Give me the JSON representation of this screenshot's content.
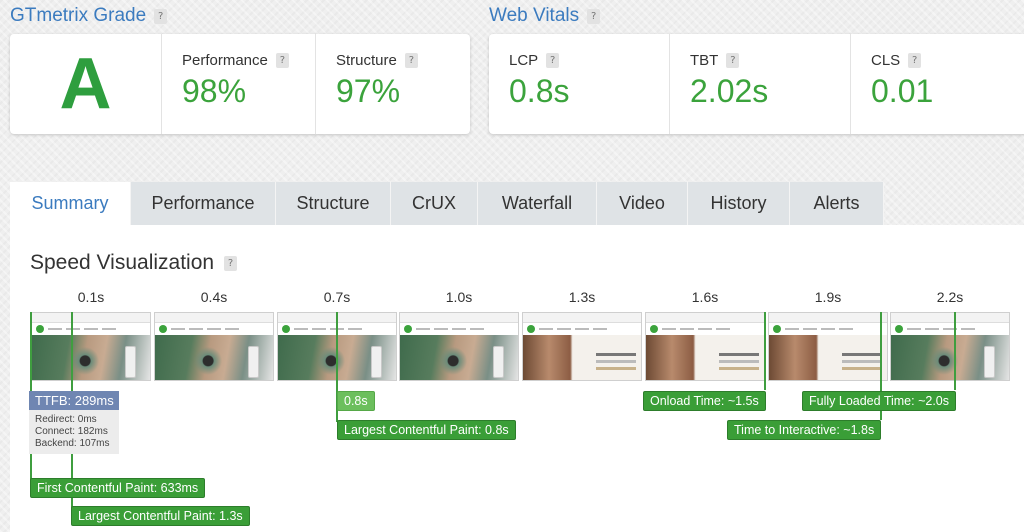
{
  "grade_section": {
    "title": "GTmetrix Grade",
    "grade": "A",
    "metrics": [
      {
        "label": "Performance",
        "value": "98%"
      },
      {
        "label": "Structure",
        "value": "97%"
      }
    ]
  },
  "vitals_section": {
    "title": "Web Vitals",
    "metrics": [
      {
        "label": "LCP",
        "value": "0.8s"
      },
      {
        "label": "TBT",
        "value": "2.02s"
      },
      {
        "label": "CLS",
        "value": "0.01"
      }
    ]
  },
  "help_glyph": "?",
  "tabs": [
    {
      "label": "Summary",
      "active": true
    },
    {
      "label": "Performance"
    },
    {
      "label": "Structure"
    },
    {
      "label": "CrUX"
    },
    {
      "label": "Waterfall"
    },
    {
      "label": "Video"
    },
    {
      "label": "History"
    },
    {
      "label": "Alerts"
    }
  ],
  "speed_viz": {
    "title": "Speed Visualization",
    "time_labels": [
      "0.1s",
      "0.4s",
      "0.7s",
      "1.0s",
      "1.3s",
      "1.6s",
      "1.9s",
      "2.2s"
    ],
    "ttfb": {
      "label": "TTFB: 289ms",
      "redirect": "Redirect: 0ms",
      "connect": "Connect: 182ms",
      "backend": "Backend: 107ms"
    },
    "markers": {
      "lcp_short": "0.8s",
      "lcp": "Largest Contentful Paint: 0.8s",
      "onload": "Onload Time: ~1.5s",
      "fully_loaded": "Fully Loaded Time: ~2.0s",
      "tti": "Time to Interactive: ~1.8s",
      "fcp": "First Contentful Paint: 633ms",
      "lcp_bottom": "Largest Contentful Paint: 1.3s"
    }
  },
  "colors": {
    "accent_blue": "#3b7bbf",
    "grade_green": "#2e9e3e",
    "marker_green": "#3a9e37",
    "ttfb_blue": "#6f86b2"
  }
}
